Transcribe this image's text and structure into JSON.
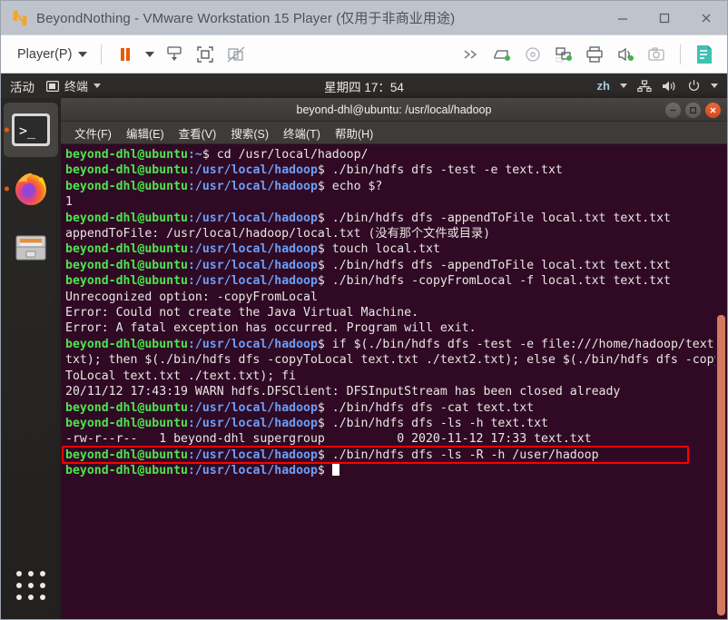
{
  "vmware": {
    "title": "BeyondNothing - VMware Workstation 15 Player (仅用于非商业用途)",
    "logo_icon": "vmware-logo-icon",
    "window_controls": [
      {
        "name": "minimize-button",
        "glyph": "–"
      },
      {
        "name": "maximize-button",
        "glyph": "☐"
      },
      {
        "name": "close-button",
        "glyph": "✕"
      }
    ],
    "toolbar": {
      "player_menu_label": "Player(P)",
      "left_icons": [
        {
          "name": "pause-vm-icon",
          "title": "Pause"
        },
        {
          "name": "pause-dropdown-icon",
          "title": "Pause options"
        },
        {
          "name": "send-ctrl-alt-del-icon",
          "title": "Send Ctrl+Alt+Del"
        },
        {
          "name": "enter-fullscreen-icon",
          "title": "Enter full screen"
        },
        {
          "name": "unity-mode-icon",
          "title": "Unity mode"
        }
      ],
      "right_icons": [
        {
          "name": "expand-toolbar-icon",
          "title": "More"
        },
        {
          "name": "hard-disk-icon",
          "title": "Hard Disk"
        },
        {
          "name": "cd-dvd-icon",
          "title": "CD/DVD"
        },
        {
          "name": "network-adapter-icon",
          "title": "Network Adapter"
        },
        {
          "name": "printer-icon",
          "title": "Printer"
        },
        {
          "name": "sound-card-icon",
          "title": "Sound Card"
        },
        {
          "name": "camera-icon",
          "title": "Camera"
        },
        {
          "name": "notes-icon",
          "title": "Notes"
        }
      ]
    }
  },
  "ubuntu": {
    "topbar": {
      "activities_label": "活动",
      "app_menu_label": "终端",
      "app_menu_icon": "terminal-window-icon",
      "clock": "星期四 17：54",
      "language_indicator": "zh",
      "status_icons": [
        {
          "name": "network-icon"
        },
        {
          "name": "volume-icon"
        },
        {
          "name": "power-icon"
        }
      ]
    },
    "dock": {
      "items": [
        {
          "name": "dock-item-terminal",
          "label": "Terminal",
          "icon": "terminal-icon",
          "running": true,
          "active": true
        },
        {
          "name": "dock-item-firefox",
          "label": "Firefox",
          "icon": "firefox-icon",
          "running": true,
          "active": false
        },
        {
          "name": "dock-item-files",
          "label": "Files",
          "icon": "files-cabinet-icon",
          "running": false,
          "active": false
        }
      ],
      "show_applications_label": "Show Applications"
    }
  },
  "terminal": {
    "window_title": "beyond-dhl@ubuntu: /usr/local/hadoop",
    "window_controls": [
      {
        "name": "terminal-minimize-button",
        "glyph": "–"
      },
      {
        "name": "terminal-maximize-button",
        "glyph": "□"
      },
      {
        "name": "terminal-close-button",
        "glyph": "✕"
      }
    ],
    "menu_items": [
      {
        "name": "menu-file",
        "label": "文件(F)"
      },
      {
        "name": "menu-edit",
        "label": "编辑(E)"
      },
      {
        "name": "menu-view",
        "label": "查看(V)"
      },
      {
        "name": "menu-search",
        "label": "搜索(S)"
      },
      {
        "name": "menu-terminal",
        "label": "终端(T)"
      },
      {
        "name": "menu-help",
        "label": "帮助(H)"
      }
    ],
    "colors": {
      "background": "#300a24",
      "user_host": "#4ee44e",
      "path": "#6c9ef8",
      "text": "#e8e6e3",
      "highlight_box": "#fe0000",
      "scrollbar": "#d3795e"
    },
    "user_host": "beyond-dhl@ubuntu",
    "lines": [
      {
        "type": "prompt",
        "path": ":~$",
        "command": " cd /usr/local/hadoop/"
      },
      {
        "type": "prompt",
        "path": ":/usr/local/hadoop$",
        "command": " ./bin/hdfs dfs -test -e text.txt"
      },
      {
        "type": "prompt",
        "path": ":/usr/local/hadoop$",
        "command": " echo $?"
      },
      {
        "type": "output",
        "text": "1"
      },
      {
        "type": "prompt",
        "path": ":/usr/local/hadoop$",
        "command": " ./bin/hdfs dfs -appendToFile local.txt text.txt"
      },
      {
        "type": "output",
        "text": "appendToFile: /usr/local/hadoop/local.txt (没有那个文件或目录)"
      },
      {
        "type": "prompt",
        "path": ":/usr/local/hadoop$",
        "command": " touch local.txt"
      },
      {
        "type": "prompt",
        "path": ":/usr/local/hadoop$",
        "command": " ./bin/hdfs dfs -appendToFile local.txt text.txt"
      },
      {
        "type": "prompt",
        "path": ":/usr/local/hadoop$",
        "command": " ./bin/hdfs -copyFromLocal -f local.txt text.txt"
      },
      {
        "type": "output",
        "text": "Unrecognized option: -copyFromLocal"
      },
      {
        "type": "output",
        "text": "Error: Could not create the Java Virtual Machine."
      },
      {
        "type": "output",
        "text": "Error: A fatal exception has occurred. Program will exit."
      },
      {
        "type": "prompt",
        "path": ":/usr/local/hadoop$",
        "command": " if $(./bin/hdfs dfs -test -e file:///home/hadoop/text.txt); then $(./bin/hdfs dfs -copyToLocal text.txt ./text2.txt); else $(./bin/hdfs dfs -copyToLocal text.txt ./text.txt); fi"
      },
      {
        "type": "output",
        "text": "20/11/12 17:43:19 WARN hdfs.DFSClient: DFSInputStream has been closed already"
      },
      {
        "type": "prompt",
        "path": ":/usr/local/hadoop$",
        "command": " ./bin/hdfs dfs -cat text.txt"
      },
      {
        "type": "prompt",
        "path": ":/usr/local/hadoop$",
        "command": " ./bin/hdfs dfs -ls -h text.txt"
      },
      {
        "type": "output",
        "text": "-rw-r--r--   1 beyond-dhl supergroup          0 2020-11-12 17:33 text.txt"
      },
      {
        "type": "prompt",
        "path": ":/usr/local/hadoop$",
        "command": " ./bin/hdfs dfs -ls -R -h /user/hadoop",
        "highlighted": true
      },
      {
        "type": "prompt",
        "path": ":/usr/local/hadoop$",
        "command": " ",
        "cursor": true
      }
    ]
  }
}
